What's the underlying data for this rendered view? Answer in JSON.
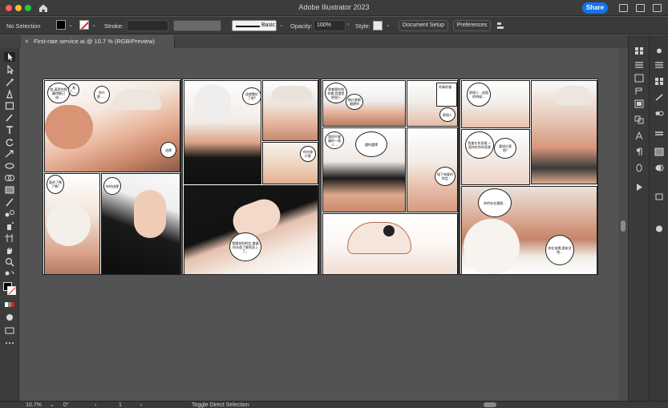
{
  "window": {
    "title": "Adobe Illustrator 2023",
    "share_label": "Share"
  },
  "control_bar": {
    "selection_status": "No Selection",
    "stroke_label": "Stroke:",
    "brush_style": "Basic",
    "opacity_label": "Opacity:",
    "opacity_value": "100%",
    "style_label": "Style:",
    "document_setup_label": "Document Setup",
    "preferences_label": "Preferences"
  },
  "document_tab": {
    "close_glyph": "×",
    "name": "First-rate service.ai @ 10.7 % (RGB/Preview)"
  },
  "comic": {
    "p1": {
      "b1": "唉,真是的我藏得都已经...",
      "b2": "為了……",
      "b3": "你什麼……",
      "b4": "這裡",
      "b5": "真的了嗎了嗎?",
      "b6": "你的這裡"
    },
    "p2": {
      "b1": "這就整好了吧?",
      "b2": "你在做什麼",
      "b3": "我跟你的約定,會讓你永遠了解到身上了。"
    },
    "p3": {
      "b1": "我會替你和你做,我還是那個人",
      "b2": "做什麼都隨便你",
      "b3": "你真的會...",
      "b4": "那個人",
      "b5": "我再不會讓你一個人...",
      "b6": "隨你選擇",
      "b7": "接下來要的約定"
    },
    "p4": {
      "b1": "那個人...這個的時候...",
      "b2": "我會在你身邊,一直待在你的身邊",
      "b3": "要說什麼吧?",
      "b4": "你的存在讓我...",
      "b5": "你在這裡,請安全地..."
    }
  },
  "status_bar": {
    "zoom": "10.7%",
    "rotation": "0°",
    "artboard_number": "1",
    "current_tool": "Toggle Direct Selection"
  },
  "icons": [
    "home-icon",
    "close-icon",
    "selection-tool-icon",
    "direct-selection-icon",
    "pen-tool-icon",
    "type-tool-icon",
    "rectangle-tool-icon",
    "zoom-icon",
    "hand-icon"
  ]
}
